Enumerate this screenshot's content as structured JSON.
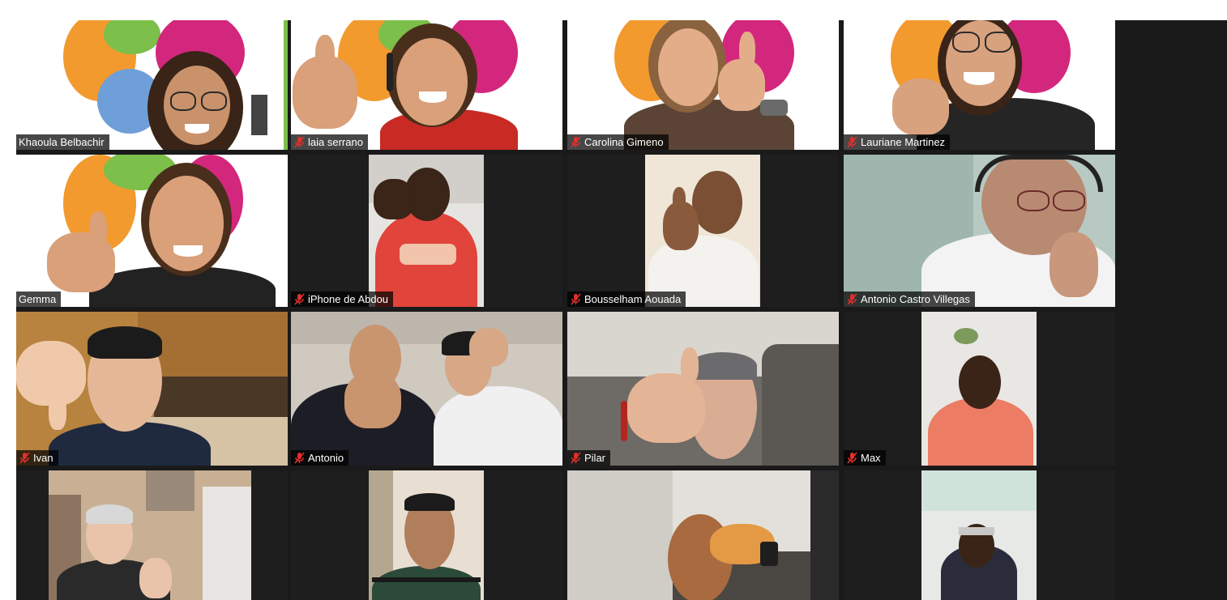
{
  "meeting": {
    "participants": [
      {
        "name": "Khaoula Belbachir",
        "muted": false,
        "active_speaker": true
      },
      {
        "name": "laia serrano",
        "muted": true
      },
      {
        "name": "Carolina Gimeno",
        "muted": true
      },
      {
        "name": "Lauriane Martinez",
        "muted": true
      },
      {
        "name": "Gemma",
        "muted": false
      },
      {
        "name": "iPhone de Abdou",
        "muted": true
      },
      {
        "name": "Bousselham Aouada",
        "muted": true
      },
      {
        "name": "Antonio Castro Villegas",
        "muted": true
      },
      {
        "name": "Ivan",
        "muted": true
      },
      {
        "name": "Antonio",
        "muted": true
      },
      {
        "name": "Pilar",
        "muted": true
      },
      {
        "name": "Max",
        "muted": true
      }
    ],
    "colors": {
      "active_speaker_border": "#d7e02e",
      "mic_off": "#e0302c",
      "tile_background": "#1e1e1e"
    }
  }
}
